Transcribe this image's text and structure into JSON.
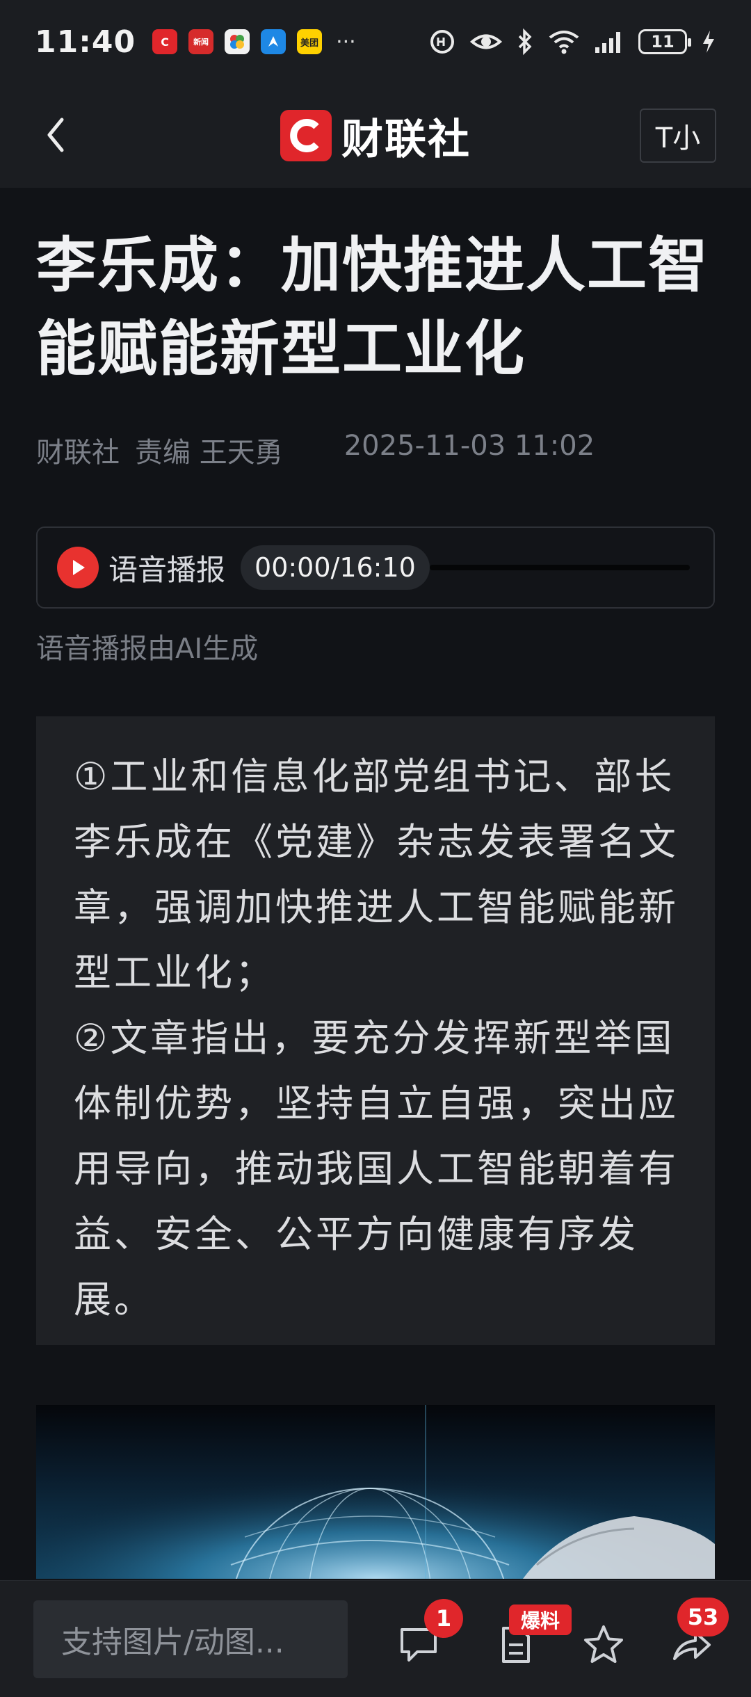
{
  "status_bar": {
    "time": "11:40",
    "apps": [
      {
        "icon": "cailian-app-icon",
        "label": "C",
        "color": "#e0262b"
      },
      {
        "icon": "news-app-icon",
        "label": "新闻",
        "color": "#d62b2b"
      },
      {
        "icon": "flower-app-icon",
        "label": "",
        "color": "#f2f2f2"
      },
      {
        "icon": "arrow-app-icon",
        "label": "",
        "color": "#1e88e5"
      },
      {
        "icon": "meituan-app-icon",
        "label": "美团",
        "color": "#ffd100"
      }
    ],
    "more": "···",
    "battery": "11"
  },
  "header": {
    "logo_text": "财联社",
    "font_size_button": "T小"
  },
  "article": {
    "title": "李乐成：加快推进人工智能赋能新型工业化",
    "source": "财联社",
    "editor": "责编 王天勇",
    "date": "2025-11-03 11:02",
    "audio": {
      "label": "语音播报",
      "time": "00:00/16:10",
      "progress": 0,
      "note": "语音播报由AI生成"
    },
    "summary": [
      "①工业和信息化部党组书记、部长李乐成在《党建》杂志发表署名文章，强调加快推进人工智能赋能新型工业化；",
      "②文章指出，要充分发挥新型举国体制优势，坚持自立自强，突出应用导向，推动我国人工智能朝着有益、安全、公平方向健康有序发展。"
    ]
  },
  "bottom_bar": {
    "comment_placeholder": "支持图片/动图...",
    "comment_count": "1",
    "tip_badge": "爆料",
    "share_count": "53"
  },
  "colors": {
    "brand_red": "#e0262b",
    "background": "#111317",
    "panel": "#1f2125"
  }
}
